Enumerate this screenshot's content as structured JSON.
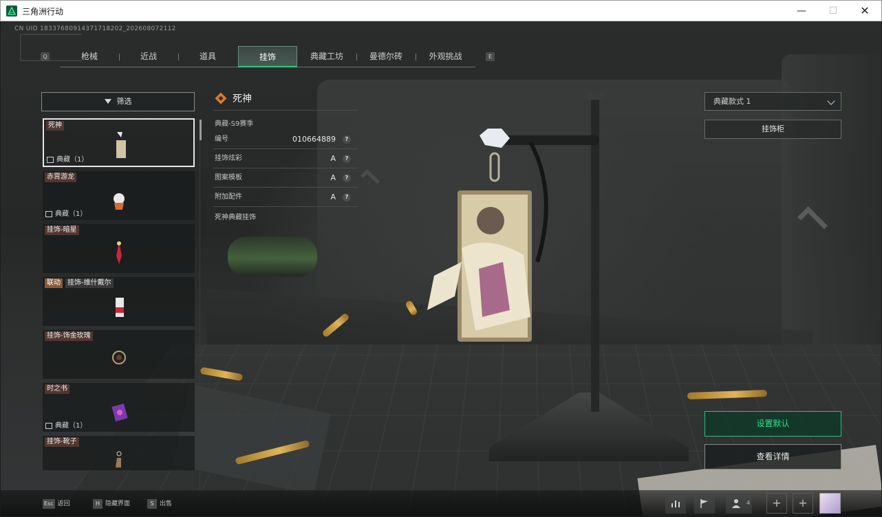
{
  "window": {
    "title": "三角洲行动",
    "minimize": "—",
    "maximize": "☐",
    "close": "✕"
  },
  "hud": {
    "cn_uid": "CN UID 18337680914371718202_202608072112",
    "key_prev": "Q",
    "key_next": "E"
  },
  "tabs": [
    {
      "label": "枪械",
      "active": false
    },
    {
      "label": "近战",
      "active": false
    },
    {
      "label": "道具",
      "active": false
    },
    {
      "label": "挂饰",
      "active": true
    },
    {
      "label": "典藏工坊",
      "active": false
    },
    {
      "label": "曼德尔砖",
      "active": false
    },
    {
      "label": "外观挑战",
      "active": false
    }
  ],
  "filter": {
    "label": "筛选"
  },
  "list": [
    {
      "name": "死神",
      "badge": "典藏（1）",
      "selected": true
    },
    {
      "name": "赤霄游龙",
      "badge": "典藏（1）",
      "selected": false
    },
    {
      "name": "挂饰-暗星",
      "badge": "",
      "selected": false
    },
    {
      "tag": "联动",
      "name": "挂饰-维什戴尔",
      "badge": "",
      "selected": false
    },
    {
      "name": "挂饰-饰金玫瑰",
      "badge": "",
      "selected": false
    },
    {
      "name": "时之书",
      "badge": "典藏（1）",
      "selected": false
    },
    {
      "name": "挂饰-靴子",
      "badge": "",
      "selected": false
    }
  ],
  "detail": {
    "title": "死神",
    "season": "典藏-S9赛季",
    "rows": [
      {
        "label": "编号",
        "value": "010664889"
      },
      {
        "label": "挂饰炫彩",
        "value": "A"
      },
      {
        "label": "图案模板",
        "value": "A"
      },
      {
        "label": "附加配件",
        "value": "A"
      }
    ],
    "help": "?",
    "description": "死神典藏挂饰"
  },
  "right": {
    "style_select": "典藏款式 1",
    "cabinet": "挂饰柜",
    "set_default": "设置默认",
    "view_detail": "查看详情"
  },
  "bottom": {
    "hints": [
      {
        "key": "Esc",
        "label": "返回"
      },
      {
        "key": "H",
        "label": "隐藏界面"
      },
      {
        "key": "S",
        "label": "出售"
      }
    ],
    "squad_count": "4",
    "plus": "+"
  },
  "colors": {
    "accent": "#2ecf82",
    "accent_text": "#2ee38e",
    "tag_collab": "#8a5a36"
  },
  "icons": [
    "app-logo-icon",
    "filter-icon",
    "diamond-emblem-icon",
    "chevron-down-icon",
    "stats-icon",
    "flag-icon",
    "squad-icon",
    "help-icon"
  ]
}
